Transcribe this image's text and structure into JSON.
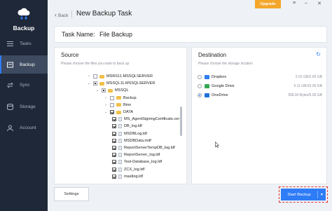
{
  "app": {
    "logo_text": "Backup"
  },
  "sidebar": {
    "items": [
      {
        "label": "Tasks",
        "icon": "list-icon"
      },
      {
        "label": "Backup",
        "icon": "backup-icon",
        "active": true
      },
      {
        "label": "Sync",
        "icon": "sync-icon"
      },
      {
        "label": "Storage",
        "icon": "storage-icon"
      },
      {
        "label": "Account",
        "icon": "account-icon"
      }
    ]
  },
  "header": {
    "back_label": "Back",
    "title": "New Backup Task",
    "upgrade_label": "Upgrade"
  },
  "task": {
    "label": "Task Name:",
    "value": "File Backup"
  },
  "source": {
    "title": "Source",
    "hint": "Please choose the files you want to back up",
    "tree": [
      {
        "label": "MSRS11.MSSQLSERVER",
        "type": "folder",
        "toggle": "›",
        "check": "none"
      },
      {
        "label": "MSSQL11.MSSQLSERVER",
        "type": "folder",
        "toggle": "⌄",
        "check": "partial"
      },
      {
        "label": "MSSQL",
        "type": "folder",
        "toggle": "⌄",
        "check": "partial"
      },
      {
        "label": "Backup",
        "type": "folder",
        "toggle": "›",
        "check": "none"
      },
      {
        "label": "Binn",
        "type": "folder",
        "toggle": "›",
        "check": "none"
      },
      {
        "label": "DATA",
        "type": "folder",
        "toggle": "⌄",
        "check": "checked"
      },
      {
        "label": "MS_AgentSigningCertificate.cer",
        "type": "file",
        "check": "checked"
      },
      {
        "label": "DB_log.ldf",
        "type": "file",
        "check": "checked"
      },
      {
        "label": "MSDBLog.ldf",
        "type": "file",
        "check": "checked"
      },
      {
        "label": "MSDBData.mdf",
        "type": "file",
        "check": "checked"
      },
      {
        "label": "ReportServerTempDB_log.ldf",
        "type": "file",
        "check": "checked"
      },
      {
        "label": "ReportServer_log.ldf",
        "type": "file",
        "check": "checked"
      },
      {
        "label": "Test-Database_log.ldf",
        "type": "file",
        "check": "checked"
      },
      {
        "label": "ZCX_log.ldf",
        "type": "file",
        "check": "checked"
      },
      {
        "label": "mastlog.ldf",
        "type": "file",
        "check": "checked"
      }
    ]
  },
  "destination": {
    "title": "Destination",
    "hint": "Please choose the storage location",
    "items": [
      {
        "label": "Dropbox",
        "size": "2.01 GB/2.00 GB",
        "selected": false,
        "color": "#2f7ff0"
      },
      {
        "label": "Google Drive",
        "size": "5.11 GB/15.00 GB",
        "selected": false,
        "color": "#34a853"
      },
      {
        "label": "OneDrive",
        "size": "358.30 Bytes/5.00 GB",
        "selected": true,
        "color": "#1e73d8"
      }
    ]
  },
  "footer": {
    "settings_label": "Settings",
    "start_label": "Start Backup"
  }
}
